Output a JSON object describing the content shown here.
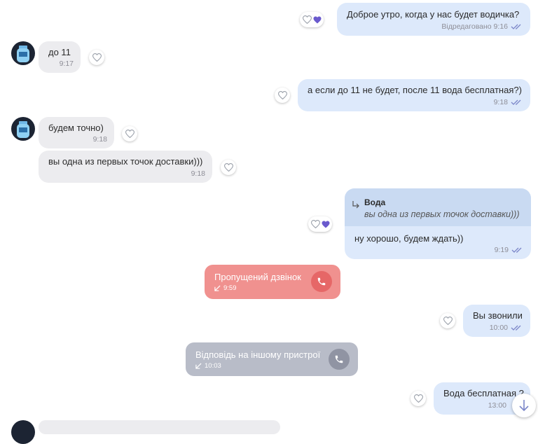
{
  "messages": {
    "m1": {
      "text": "Доброе утро, когда у нас будет водичка?",
      "time": "Відредаговано 9:16"
    },
    "m2": {
      "text": "до 11",
      "time": "9:17"
    },
    "m3": {
      "text": "а если до 11 не будет, после 11 вода бесплатная?)",
      "time": "9:18"
    },
    "m4": {
      "text": "будем точно)",
      "time": "9:18"
    },
    "m5": {
      "text": "вы одна из первых точок доставки)))",
      "time": "9:18"
    },
    "m6": {
      "reply_author": "Вода",
      "reply_text": "вы одна из первых точок доставки)))",
      "text": "ну хорошо, будем ждать))",
      "time": "9:19"
    },
    "m8": {
      "text": "Вы звонили",
      "time": "10:00"
    },
    "m10": {
      "text": "Вода бесплатная ?",
      "time": "13:00"
    }
  },
  "calls": {
    "missed": {
      "label": "Пропущений дзвінок",
      "time": "9:59",
      "color": "#f0918f"
    },
    "other_device": {
      "label": "Відповідь на іншому пристрої",
      "time": "10:03",
      "color": "#b8bcc8"
    }
  },
  "icons": {
    "heart": "heart-icon",
    "heart_filled": "heart-filled-icon",
    "read_ticks": "double-check-icon",
    "phone": "phone-icon",
    "reply": "reply-arrow-icon",
    "scroll": "arrow-down-icon"
  },
  "colors": {
    "outgoing": "#dde9fb",
    "incoming": "#ececef",
    "accent": "#6a5acd"
  }
}
